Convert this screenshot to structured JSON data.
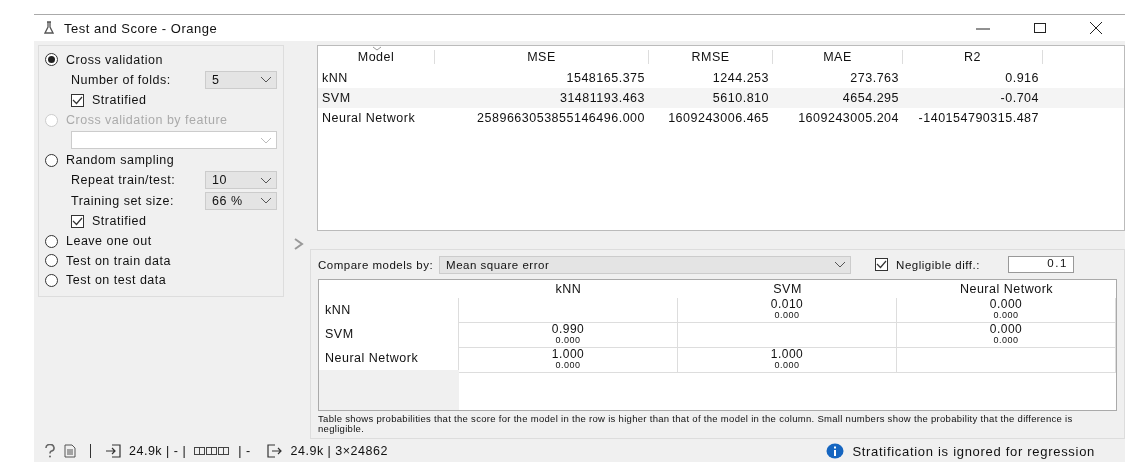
{
  "window": {
    "title": "Test and Score - Orange"
  },
  "sampling": {
    "options": [
      {
        "label": "Cross validation",
        "selected": true,
        "disabled": false,
        "settings": [
          {
            "kind": "combo",
            "label": "Number of folds:",
            "value": "5"
          },
          {
            "kind": "check",
            "label": "Stratified",
            "checked": true
          }
        ]
      },
      {
        "label": "Cross validation by feature",
        "selected": false,
        "disabled": true,
        "settings": [
          {
            "kind": "combo"
          }
        ]
      },
      {
        "label": "Random sampling",
        "selected": false,
        "disabled": false,
        "settings": [
          {
            "kind": "combo",
            "label": "Repeat train/test:",
            "value": "10"
          },
          {
            "kind": "combo",
            "label": "Training set size:",
            "value": "66 %"
          },
          {
            "kind": "check",
            "label": "Stratified",
            "checked": true
          }
        ]
      },
      {
        "label": "Leave one out",
        "selected": false,
        "disabled": false
      },
      {
        "label": "Test on train data",
        "selected": false,
        "disabled": false
      },
      {
        "label": "Test on test data",
        "selected": false,
        "disabled": false
      }
    ]
  },
  "scores": {
    "columns": [
      "Model",
      "MSE",
      "RMSE",
      "MAE",
      "R2"
    ],
    "rows": [
      [
        "kNN",
        "1548165.375",
        "1244.253",
        "273.763",
        "0.916"
      ],
      [
        "SVM",
        "31481193.463",
        "5610.810",
        "4654.295",
        "-0.704"
      ],
      [
        "Neural Network",
        "2589663053855146496.000",
        "1609243006.465",
        "1609243005.204",
        "-140154790315.487"
      ]
    ]
  },
  "compare": {
    "label": "Compare models by:",
    "value": "Mean square error",
    "negligible": {
      "label": "Negligible diff.:",
      "checked": true,
      "value": "0.1"
    },
    "columns": [
      "kNN",
      "SVM",
      "Neural Network"
    ],
    "rows": [
      {
        "name": "kNN",
        "cells": [
          {
            "kind": "empty"
          },
          {
            "kind": "prob",
            "value": "0.010",
            "small": "0.000"
          },
          {
            "kind": "prob",
            "value": "0.000",
            "small": "0.000"
          }
        ]
      },
      {
        "name": "SVM",
        "cells": [
          {
            "kind": "prob",
            "value": "0.990",
            "small": "0.000"
          },
          {
            "kind": "empty"
          },
          {
            "kind": "prob",
            "value": "0.000",
            "small": "0.000"
          }
        ]
      },
      {
        "name": "Neural Network",
        "cells": [
          {
            "kind": "prob",
            "value": "1.000",
            "small": "0.000"
          },
          {
            "kind": "prob",
            "value": "1.000",
            "small": "0.000"
          },
          {
            "kind": "empty"
          }
        ]
      }
    ],
    "note": "Table shows probabilities that the score for the model in the row is higher than that of the model in the column. Small numbers show the probability that the difference is negligible."
  },
  "status_bar": {
    "input": "24.9k | - |",
    "input_rest": "| -",
    "output": "24.9k | 3×24862",
    "message": "Stratification is ignored for regression"
  }
}
